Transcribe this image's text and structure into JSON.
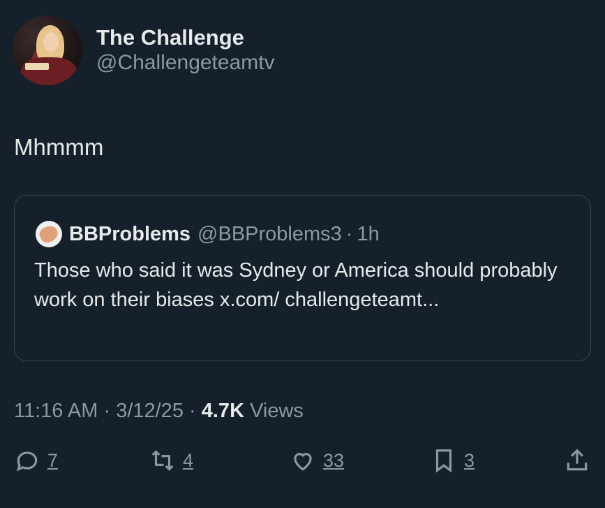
{
  "author": {
    "display_name": "The Challenge",
    "handle": "@Challengeteamtv"
  },
  "tweet": {
    "text": "Mhmmm"
  },
  "quoted": {
    "display_name": "BBProblems",
    "handle": "@BBProblems3",
    "separator": "·",
    "time": "1h",
    "body": "Those who said it was Sydney or America should probably work on their biases x.com/ challengeteamt..."
  },
  "meta": {
    "time": "11:16 AM",
    "sep1": "·",
    "date": "3/12/25",
    "sep2": "·",
    "views_count": "4.7K",
    "views_label": "Views"
  },
  "actions": {
    "replies": "7",
    "reposts": "4",
    "likes": "33",
    "bookmarks": "3"
  },
  "icons": {
    "reply": "reply-icon",
    "repost": "repost-icon",
    "like": "heart-icon",
    "bookmark": "bookmark-icon",
    "share": "share-icon"
  },
  "colors": {
    "background": "#15202b",
    "primary_text": "#e7e9ea",
    "secondary_text": "#8b98a5",
    "border": "#38444d"
  }
}
